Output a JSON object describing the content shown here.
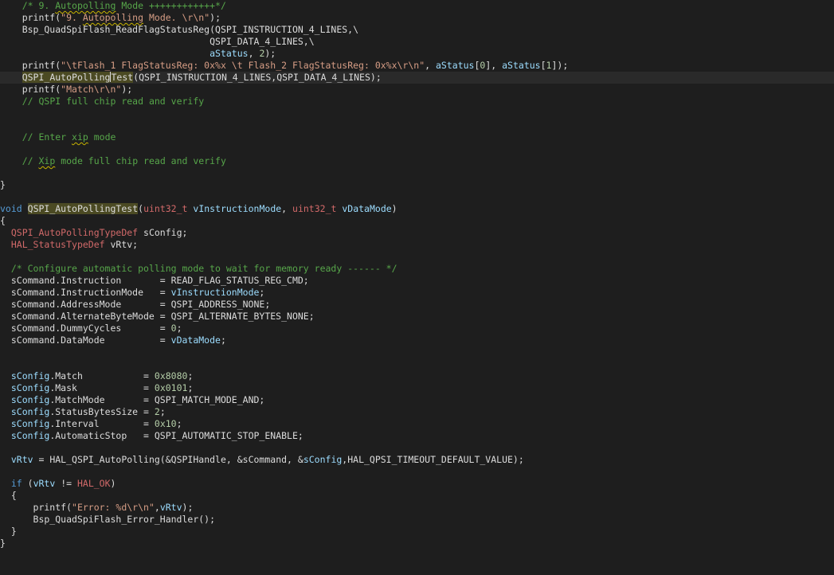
{
  "theme": {
    "background": "#1e1e1e",
    "text": "#dcdcdc",
    "comment": "#57a64a",
    "string": "#d69d85",
    "number": "#b5cea8",
    "keyword": "#569cd6",
    "type": "#d16969",
    "variable": "#9cdcfe",
    "highlight": "#4b4a23"
  },
  "lines": [
    [
      {
        "t": "    "
      },
      {
        "t": "/* 9. ",
        "c": "cm"
      },
      {
        "t": "Autopolling",
        "c": "cm squig"
      },
      {
        "t": " Mode ++++++++++++*/",
        "c": "cm"
      }
    ],
    [
      {
        "t": "    printf("
      },
      {
        "t": "\"9. ",
        "c": "str"
      },
      {
        "t": "Autopolling",
        "c": "str squig"
      },
      {
        "t": " Mode. \\r\\n\"",
        "c": "str"
      },
      {
        "t": ");"
      }
    ],
    [
      {
        "t": "    Bsp_QuadSpiFlash_ReadFlagStatusReg(QSPI_INSTRUCTION_4_LINES,\\"
      }
    ],
    [
      {
        "t": "                                      QSPI_DATA_4_LINES,\\"
      }
    ],
    [
      {
        "t": "                                      "
      },
      {
        "t": "aStatus",
        "c": "var"
      },
      {
        "t": ", "
      },
      {
        "t": "2",
        "c": "num"
      },
      {
        "t": ");"
      }
    ],
    [
      {
        "t": "    printf("
      },
      {
        "t": "\"\\tFlash_1 FlagStatusReg: 0x%x \\t Flash_2 FlagStatusReg: 0x%x\\r\\n\"",
        "c": "str"
      },
      {
        "t": ", "
      },
      {
        "t": "aStatus",
        "c": "var"
      },
      {
        "t": "["
      },
      {
        "t": "0",
        "c": "num"
      },
      {
        "t": "], "
      },
      {
        "t": "aStatus",
        "c": "var"
      },
      {
        "t": "["
      },
      {
        "t": "1",
        "c": "num"
      },
      {
        "t": "]);"
      }
    ],
    [
      {
        "t": "    "
      },
      {
        "t": "QSPI_AutoPolling",
        "c": "fn-hl"
      },
      {
        "caret": true
      },
      {
        "t": "Test",
        "c": "fn-hl"
      },
      {
        "t": "(QSPI_INSTRUCTION_4_LINES,QSPI_DATA_4_LINES);"
      }
    ],
    [
      {
        "t": "    printf("
      },
      {
        "t": "\"Match\\r\\n\"",
        "c": "str"
      },
      {
        "t": ");"
      }
    ],
    [
      {
        "t": "    "
      },
      {
        "t": "// QSPI full chip read and verify",
        "c": "cm"
      }
    ],
    [],
    [],
    [
      {
        "t": "    "
      },
      {
        "t": "// Enter ",
        "c": "cm"
      },
      {
        "t": "xip",
        "c": "cm squig"
      },
      {
        "t": " mode",
        "c": "cm"
      }
    ],
    [],
    [
      {
        "t": "    "
      },
      {
        "t": "// ",
        "c": "cm"
      },
      {
        "t": "Xip",
        "c": "cm squig"
      },
      {
        "t": " mode full chip read and verify",
        "c": "cm"
      }
    ],
    [],
    [
      {
        "t": "}"
      }
    ],
    [],
    [
      {
        "t": "void",
        "c": "kw"
      },
      {
        "t": " "
      },
      {
        "t": "QSPI_AutoPollingTest",
        "c": "fn-hl"
      },
      {
        "t": "("
      },
      {
        "t": "uint32_t",
        "c": "typ"
      },
      {
        "t": " "
      },
      {
        "t": "vInstructionMode",
        "c": "var"
      },
      {
        "t": ", "
      },
      {
        "t": "uint32_t",
        "c": "typ"
      },
      {
        "t": " "
      },
      {
        "t": "vDataMode",
        "c": "var"
      },
      {
        "t": ")"
      }
    ],
    [
      {
        "t": "{"
      }
    ],
    [
      {
        "t": "  "
      },
      {
        "t": "QSPI_AutoPollingTypeDef",
        "c": "typ"
      },
      {
        "t": " sConfig;"
      }
    ],
    [
      {
        "t": "  "
      },
      {
        "t": "HAL_StatusTypeDef",
        "c": "typ"
      },
      {
        "t": " vRtv;"
      }
    ],
    [],
    [
      {
        "t": "  "
      },
      {
        "t": "/* Configure automatic polling mode to wait for memory ready ------ */",
        "c": "cm"
      }
    ],
    [
      {
        "t": "  sCommand.Instruction       = READ_FLAG_STATUS_REG_CMD;"
      }
    ],
    [
      {
        "t": "  sCommand.InstructionMode   = "
      },
      {
        "t": "vInstructionMode",
        "c": "var"
      },
      {
        "t": ";"
      }
    ],
    [
      {
        "t": "  sCommand.AddressMode       = QSPI_ADDRESS_NONE;"
      }
    ],
    [
      {
        "t": "  sCommand.AlternateByteMode = QSPI_ALTERNATE_BYTES_NONE;"
      }
    ],
    [
      {
        "t": "  sCommand.DummyCycles       = "
      },
      {
        "t": "0",
        "c": "num"
      },
      {
        "t": ";"
      }
    ],
    [
      {
        "t": "  sCommand.DataMode          = "
      },
      {
        "t": "vDataMode",
        "c": "var"
      },
      {
        "t": ";"
      }
    ],
    [],
    [],
    [
      {
        "t": "  "
      },
      {
        "t": "sConfig",
        "c": "var"
      },
      {
        "t": ".Match           = "
      },
      {
        "t": "0x8080",
        "c": "num"
      },
      {
        "t": ";"
      }
    ],
    [
      {
        "t": "  "
      },
      {
        "t": "sConfig",
        "c": "var"
      },
      {
        "t": ".Mask            = "
      },
      {
        "t": "0x0101",
        "c": "num"
      },
      {
        "t": ";"
      }
    ],
    [
      {
        "t": "  "
      },
      {
        "t": "sConfig",
        "c": "var"
      },
      {
        "t": ".MatchMode       = QSPI_MATCH_MODE_AND;"
      }
    ],
    [
      {
        "t": "  "
      },
      {
        "t": "sConfig",
        "c": "var"
      },
      {
        "t": ".StatusBytesSize = "
      },
      {
        "t": "2",
        "c": "num"
      },
      {
        "t": ";"
      }
    ],
    [
      {
        "t": "  "
      },
      {
        "t": "sConfig",
        "c": "var"
      },
      {
        "t": ".Interval        = "
      },
      {
        "t": "0x10",
        "c": "num"
      },
      {
        "t": ";"
      }
    ],
    [
      {
        "t": "  "
      },
      {
        "t": "sConfig",
        "c": "var"
      },
      {
        "t": ".AutomaticStop   = QSPI_AUTOMATIC_STOP_ENABLE;"
      }
    ],
    [],
    [
      {
        "t": "  "
      },
      {
        "t": "vRtv",
        "c": "var"
      },
      {
        "t": " = HAL_QSPI_AutoPolling(&QSPIHandle, &sCommand, &"
      },
      {
        "t": "sConfig",
        "c": "var"
      },
      {
        "t": ",HAL_QPSI_TIMEOUT_DEFAULT_VALUE);"
      }
    ],
    [],
    [
      {
        "t": "  "
      },
      {
        "t": "if",
        "c": "kw"
      },
      {
        "t": " ("
      },
      {
        "t": "vRtv",
        "c": "var"
      },
      {
        "t": " != "
      },
      {
        "t": "HAL_OK",
        "c": "typ"
      },
      {
        "t": ")"
      }
    ],
    [
      {
        "t": "  {"
      }
    ],
    [
      {
        "t": "      printf("
      },
      {
        "t": "\"Error: %d\\r\\n\"",
        "c": "str"
      },
      {
        "t": ","
      },
      {
        "t": "vRtv",
        "c": "var"
      },
      {
        "t": ");"
      }
    ],
    [
      {
        "t": "      Bsp_QuadSpiFlash_Error_Handler();"
      }
    ],
    [
      {
        "t": "  }"
      }
    ],
    [
      {
        "t": "}"
      }
    ]
  ]
}
